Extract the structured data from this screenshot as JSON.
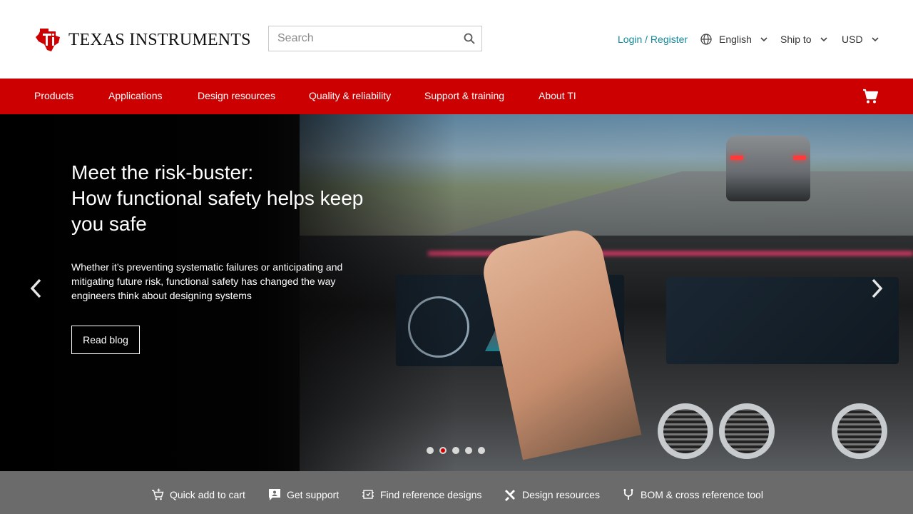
{
  "header": {
    "brand": {
      "texas_initial": "T",
      "texas_rest": "EXAS",
      "instruments_initial": "I",
      "instruments_rest": "NSTRUMENTS"
    },
    "search": {
      "placeholder": "Search",
      "icon": "search-icon"
    },
    "login_label": "Login / Register",
    "language": {
      "label": "English",
      "icon": "globe-icon"
    },
    "ship_to_label": "Ship to",
    "currency_label": "USD"
  },
  "nav": {
    "items": [
      {
        "label": "Products"
      },
      {
        "label": "Applications"
      },
      {
        "label": "Design resources"
      },
      {
        "label": "Quality & reliability"
      },
      {
        "label": "Support & training"
      },
      {
        "label": "About TI"
      }
    ],
    "cart_icon": "cart-icon"
  },
  "hero": {
    "title_line1": "Meet the risk-buster:",
    "title_line2": "How functional safety helps keep you safe",
    "description": "Whether it’s preventing systematic failures or anticipating and mitigating future risk, functional safety has changed the way engineers think about designing systems",
    "cta_label": "Read blog",
    "slide_count": 5,
    "active_slide": 2
  },
  "quickbar": {
    "items": [
      {
        "label": "Quick add to cart",
        "icon": "quick-add-cart-icon"
      },
      {
        "label": "Get support",
        "icon": "support-icon"
      },
      {
        "label": "Find reference designs",
        "icon": "reference-design-icon"
      },
      {
        "label": "Design resources",
        "icon": "tools-icon"
      },
      {
        "label": "BOM & cross reference tool",
        "icon": "cross-reference-icon"
      }
    ]
  },
  "colors": {
    "brand_red": "#cc0000",
    "link_teal": "#118899",
    "quickbar_gray": "#6b6b6b"
  }
}
